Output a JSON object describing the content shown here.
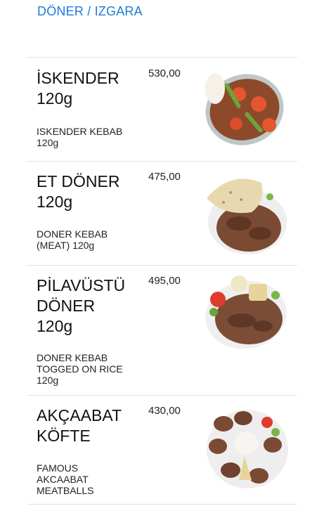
{
  "category": "DÖNER / IZGARA",
  "items": [
    {
      "name_lines": [
        "İSKENDER",
        "120g"
      ],
      "price": "530,00",
      "desc_lines": [
        "ISKENDER KEBAB",
        "120g"
      ]
    },
    {
      "name_lines": [
        "ET DÖNER",
        "120g"
      ],
      "price": "475,00",
      "desc_lines": [
        "DONER KEBAB",
        "(MEAT) 120g"
      ]
    },
    {
      "name_lines": [
        "PİLAVÜSTÜ",
        "DÖNER",
        "120g"
      ],
      "price": "495,00",
      "desc_lines": [
        "DONER KEBAB",
        "TOGGED ON RICE",
        "120g"
      ]
    },
    {
      "name_lines": [
        "AKÇAABAT",
        "KÖFTE"
      ],
      "price": "430,00",
      "desc_lines": [
        "FAMOUS",
        "AKCAABAT",
        "MEATBALLS"
      ]
    }
  ],
  "icons": [
    "iskender-dish-photo",
    "et-doner-dish-photo",
    "pilavustu-doner-dish-photo",
    "akcaabat-kofte-dish-photo"
  ]
}
